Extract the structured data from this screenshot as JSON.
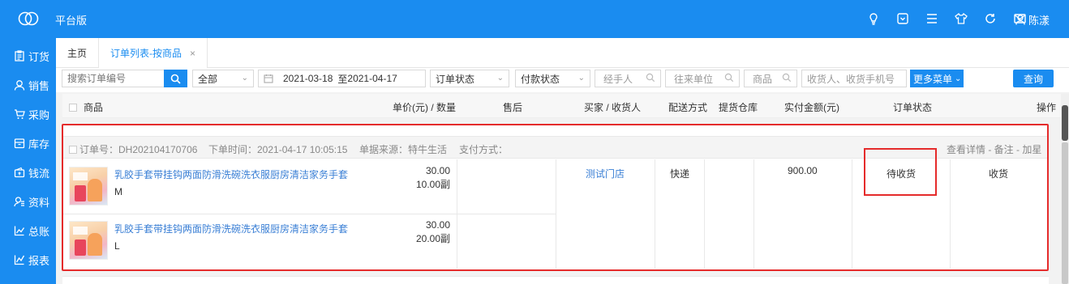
{
  "app": {
    "title": "平台版",
    "user": "陈漾",
    "accent": "#1a8cf0"
  },
  "topbar_icons": [
    "bulb-icon",
    "dropdown-box-icon",
    "menu-icon",
    "shirt-icon",
    "refresh-icon",
    "mail-icon"
  ],
  "sidebar": {
    "items": [
      {
        "label": "订货",
        "icon": "clipboard-icon"
      },
      {
        "label": "销售",
        "icon": "user-icon"
      },
      {
        "label": "采购",
        "icon": "cart-icon"
      },
      {
        "label": "库存",
        "icon": "box-icon"
      },
      {
        "label": "钱流",
        "icon": "wallet-icon"
      },
      {
        "label": "资料",
        "icon": "contacts-icon"
      },
      {
        "label": "总账",
        "icon": "chart-icon"
      },
      {
        "label": "报表",
        "icon": "report-icon"
      }
    ]
  },
  "tabs": [
    {
      "label": "主页"
    },
    {
      "label": "订单列表-按商品",
      "close": "×"
    }
  ],
  "filters": {
    "order_search_placeholder": "搜索订单编号",
    "scope": "全部",
    "date_start": "2021-03-18",
    "date_sep": "至",
    "date_end": "2021-04-17",
    "order_status": "订单状态",
    "payment_status": "付款状态",
    "handler": "经手人",
    "partner": "往来单位",
    "product": "商品",
    "receiver": "收货人、收货手机号",
    "more": "更多菜单",
    "query": "查询"
  },
  "table": {
    "headers": {
      "product": "商品",
      "price_qty": "单价(元) / 数量",
      "after_sale": "售后",
      "buyer": "买家 / 收货人",
      "delivery": "配送方式",
      "warehouse": "提货仓库",
      "paid": "实付金额(元)",
      "status": "订单状态",
      "action": "操作"
    }
  },
  "order": {
    "number_label": "订单号：DH202104170706",
    "time_label": "下单时间：2021-04-17 10:05:15",
    "source_label": "单据来源：特牛生活",
    "payment_label": "支付方式：",
    "actions": "查看详情 - 备注 - 加星",
    "buyer": "测试门店",
    "delivery": "快递",
    "paid": "900.00",
    "status": "待收货",
    "action": "收货",
    "items": [
      {
        "name": "乳胶手套带挂钩两面防滑洗碗洗衣服厨房清洁家务手套",
        "spec": "M",
        "price": "30.00",
        "qty": "10.00副"
      },
      {
        "name": "乳胶手套带挂钩两面防滑洗碗洗衣服厨房清洁家务手套",
        "spec": "L",
        "price": "30.00",
        "qty": "20.00副"
      }
    ]
  }
}
